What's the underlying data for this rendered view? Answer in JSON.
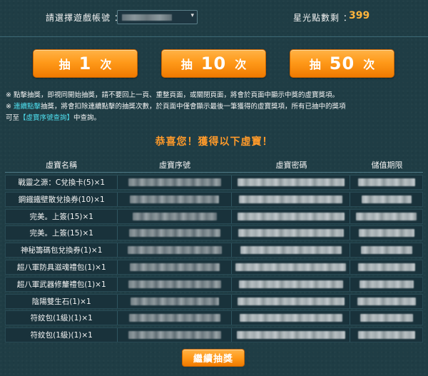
{
  "header": {
    "account_label": "請選擇遊戲帳號 ：",
    "account_select_arrow": "▾",
    "points_label": "星光點數剩 ：",
    "points_value": "399"
  },
  "draw_buttons": [
    {
      "prefix": "抽",
      "count": "1",
      "suffix": "次"
    },
    {
      "prefix": "抽",
      "count": "10",
      "suffix": "次"
    },
    {
      "prefix": "抽",
      "count": "50",
      "suffix": "次"
    }
  ],
  "notes": {
    "line1": "※ 點擊抽獎，即視同開始抽獎，請不要回上一頁、重整頁面，或關閉頁面，將會於頁面中顯示中獎的虛寶獎項。",
    "line2_prefix": "※ ",
    "line2_highlight": "連續點擊",
    "line2_rest": "抽獎，將會扣除連續點擊的抽獎次數，於頁面中僅會顯示最後一筆獲得的虛寶獎項，所有已抽中的獎項",
    "line3_prefix": "可至",
    "line3_link": "【虛寶序號查詢】",
    "line3_rest": "中查詢。"
  },
  "congrats_text": "恭喜您！獲得以下虛寶！",
  "table": {
    "headers": [
      "虛寶名稱",
      "虛寶序號",
      "虛寶密碼",
      "儲值期限"
    ],
    "rows": [
      "戰靈之源：C兌換卡(5)×1",
      "鋼鐵鐵壁散兌換券(10)×1",
      "完美。上簽(15)×1",
      "完美。上簽(15)×1",
      "神秘籌碼包兌換券(1)×1",
      "超八軍防具滋魂禮包(1)×1",
      "超八軍武器修釐禮包(1)×1",
      "陰陽雙生石(1)×1",
      "符紋包(1級)(1)×1",
      "符紋包(1級)(1)×1"
    ]
  },
  "continue_label": "繼續抽獎",
  "colors": {
    "background": "#1f3d45",
    "accent_orange": "#ff9a1a",
    "points_color": "#ffb43c",
    "highlight_cyan": "#4fe0f0"
  }
}
